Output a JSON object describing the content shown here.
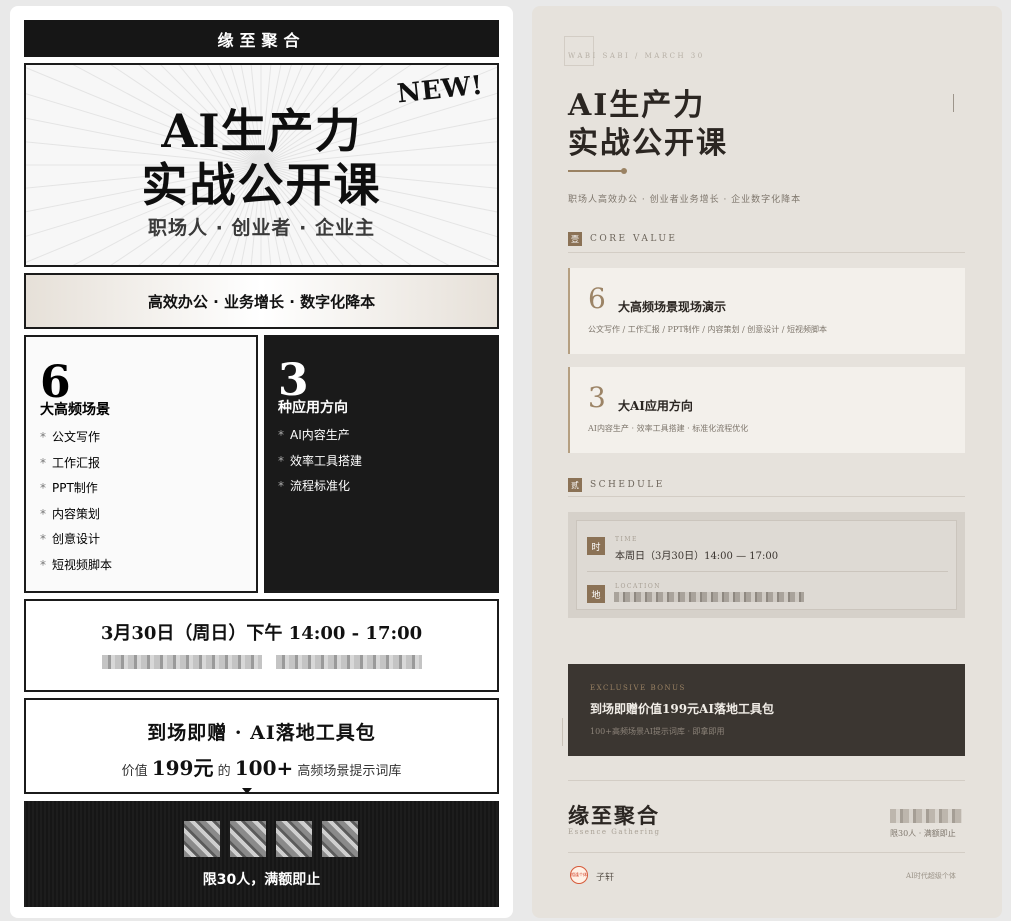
{
  "left": {
    "brand": "缘至聚合",
    "new_badge": "NEW!",
    "title_line1": "AI生产力",
    "title_line2": "实战公开课",
    "subtitle": "职场人 · 创业者 · 企业主",
    "tagline": "高效办公 · 业务增长 · 数字化降本",
    "card_scenes": {
      "number": "6",
      "title": "大高频场景",
      "items": [
        "公文写作",
        "工作汇报",
        "PPT制作",
        "内容策划",
        "创意设计",
        "短视频脚本"
      ]
    },
    "card_directions": {
      "number": "3",
      "title": "种应用方向",
      "items": [
        "AI内容生产",
        "效率工具搭建",
        "流程标准化"
      ]
    },
    "time": "3月30日（周日）下午 14:00 - 17:00",
    "gift_title": "到场即赠 · AI落地工具包",
    "gift_prefix": "价值",
    "gift_amount": "199元",
    "gift_mid": "的",
    "gift_count": "100+",
    "gift_suffix": "高频场景提示词库",
    "limit": "限30人，满额即止"
  },
  "right": {
    "kicker": "WABI SABI / MARCH 30",
    "title_line1": "AI生产力",
    "title_line2": "实战公开课",
    "subtitle": "职场人高效办公 · 创业者业务增长 · 企业数字化降本",
    "section1": {
      "badge": "壹",
      "label": "CORE VALUE"
    },
    "value_cards": [
      {
        "number": "6",
        "title": "大高频场景现场演示",
        "desc": "公文写作 / 工作汇报 / PPT制作 / 内容策划 / 创意设计 / 短视频脚本"
      },
      {
        "number": "3",
        "title": "大AI应用方向",
        "desc": "AI内容生产 · 效率工具搭建 · 标准化流程优化"
      }
    ],
    "section2": {
      "badge": "贰",
      "label": "SCHEDULE"
    },
    "schedule": {
      "time_badge": "时",
      "time_label": "TIME",
      "time_value": "本周日（3月30日）14:00 — 17:00",
      "loc_badge": "地",
      "loc_label": "LOCATION"
    },
    "bonus": {
      "kicker": "EXCLUSIVE BONUS",
      "title": "到场即赠价值199元AI落地工具包",
      "desc": "100+高频场景AI提示词库 · 即拿即用"
    },
    "brand": "缘至聚合",
    "brand_en": "Essence Gathering",
    "quota": "限30人 · 满额即止",
    "avatar_text": "相逢个体",
    "author": "子轩",
    "motto": "AI时代超级个体"
  },
  "icons": {
    "avatar": "seal-avatar-icon"
  }
}
